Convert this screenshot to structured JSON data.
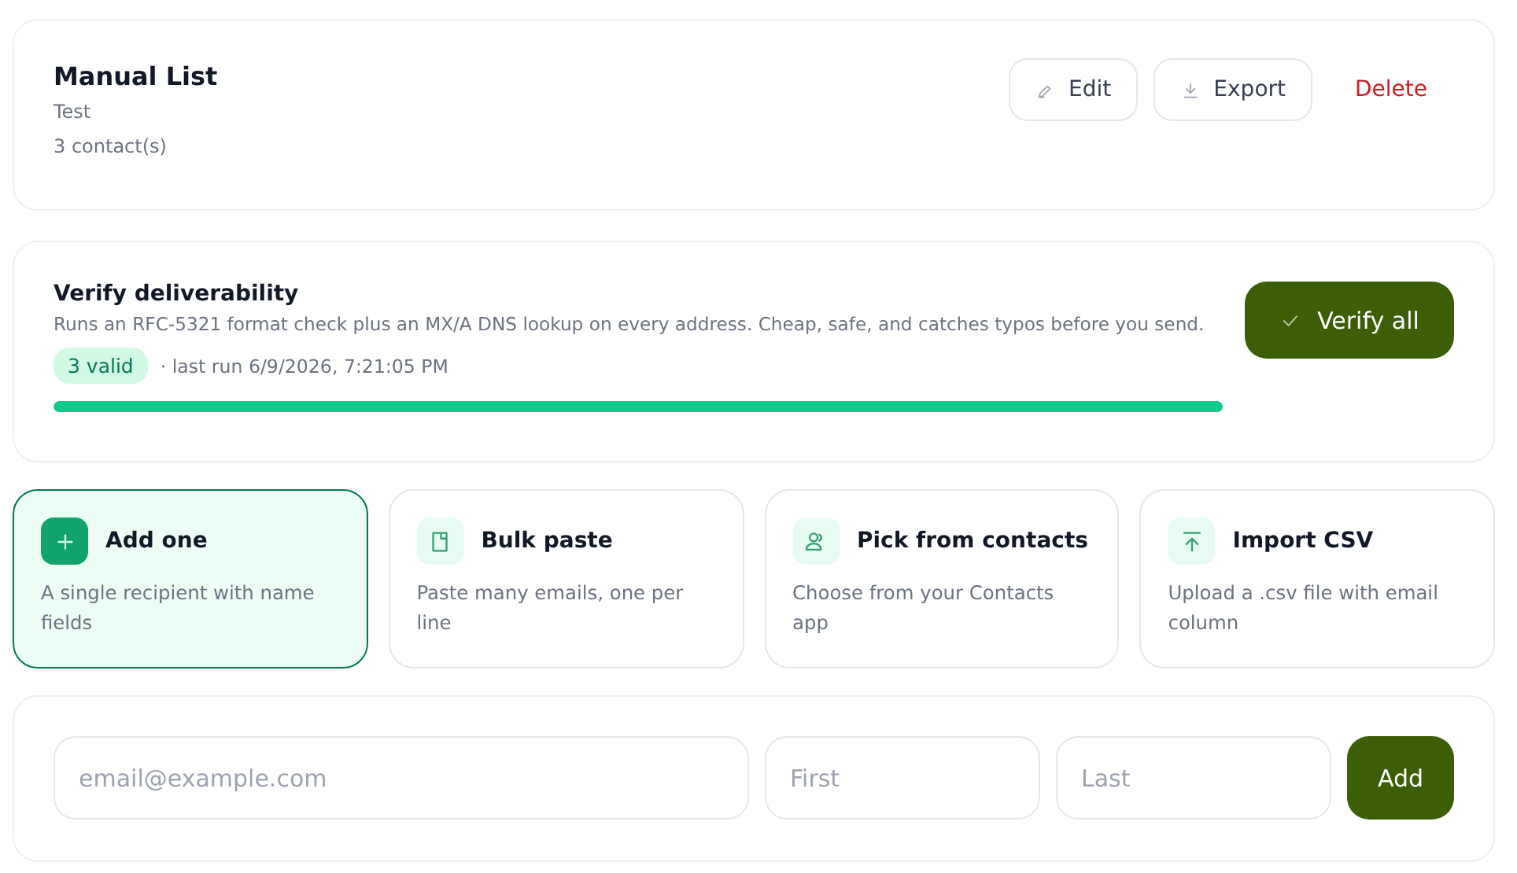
{
  "list": {
    "title": "Manual List",
    "description": "Test",
    "count": "3 contact(s)"
  },
  "actions": [
    {
      "kind": "edit",
      "label": "Edit"
    },
    {
      "kind": "export",
      "label": "Export"
    },
    {
      "kind": "delete",
      "label": "Delete"
    }
  ],
  "verify": {
    "title": "Verify deliverability",
    "description": "Runs an RFC-5321 format check plus an MX/A DNS lookup on every address. Cheap, safe, and catches typos before you send.",
    "badge": "3 valid",
    "last_run": "· last run 6/9/2026, 7:21:05 PM",
    "level": 1,
    "button": "Verify all"
  },
  "options": [
    {
      "kind": "single",
      "title": "Add one",
      "description": "A single recipient with name fields",
      "selected": true
    },
    {
      "kind": "paste",
      "title": "Bulk paste",
      "description": "Paste many emails, one per line",
      "selected": false
    },
    {
      "kind": "contacts",
      "title": "Pick from contacts",
      "description": "Choose from your Contacts app",
      "selected": false
    },
    {
      "kind": "csv",
      "title": "Import CSV",
      "description": "Upload a .csv file with email column",
      "selected": false
    }
  ],
  "form": {
    "fields": [
      {
        "placeholder": "email@example.com"
      },
      {
        "placeholder": "First"
      },
      {
        "placeholder": "Last"
      }
    ],
    "button": "Add"
  }
}
